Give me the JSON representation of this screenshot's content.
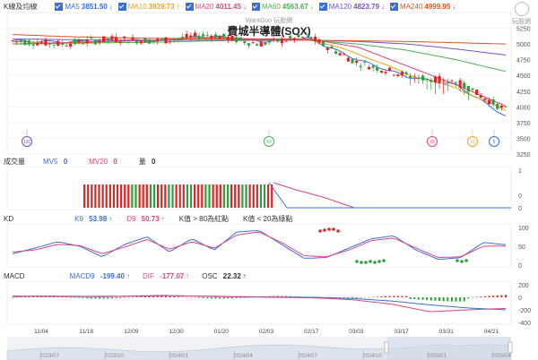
{
  "header_kline": {
    "label": "K線及均線",
    "items": [
      {
        "name": "MA5",
        "value": "3851.50",
        "arrow": "↓",
        "color": "#3a6fd8"
      },
      {
        "name": "MA10",
        "value": "3939.73",
        "arrow": "↑",
        "color": "#e8a317"
      },
      {
        "name": "MA20",
        "value": "4011.45",
        "arrow": "↓",
        "color": "#e0457b"
      },
      {
        "name": "MA60",
        "value": "4563.67",
        "arrow": "↓",
        "color": "#4caf50"
      },
      {
        "name": "MA120",
        "value": "4823.79",
        "arrow": "↓",
        "color": "#7b4fc9"
      },
      {
        "name": "MA240",
        "value": "4999.95",
        "arrow": "↓",
        "color": "#e0541d"
      }
    ]
  },
  "watermark": "WantGoo 玩股網",
  "chart_title": "費城半導體(SOX)",
  "logo_text": "玩股網",
  "header_volume": {
    "label": "成交量",
    "items": [
      {
        "name": "MV5",
        "value": "0",
        "color": "#3a6fd8"
      },
      {
        "name": "MV20",
        "value": "0",
        "color": "#e0457b"
      },
      {
        "name": "量",
        "value": "0",
        "color": "#333333"
      }
    ]
  },
  "header_kd": {
    "label": "KD",
    "items": [
      {
        "name": "K9",
        "value": "53.98",
        "arrow": "↑",
        "color": "#3a6fd8"
      },
      {
        "name": "D9",
        "value": "50.73",
        "arrow": "↑",
        "color": "#e0457b"
      }
    ],
    "notes": [
      "K值 > 80為紅點",
      "K值 < 20為綠點"
    ]
  },
  "header_macd": {
    "label": "MACD",
    "items": [
      {
        "name": "MACD9",
        "value": "-199.40",
        "arrow": "↑",
        "color": "#3a6fd8"
      },
      {
        "name": "DIF",
        "value": "-177.07",
        "arrow": "↑",
        "color": "#e0457b"
      },
      {
        "name": "OSC",
        "value": "22.32",
        "arrow": "↑",
        "color": "#333333"
      }
    ]
  },
  "price_axis": [
    "5250",
    "5000",
    "4750",
    "4500",
    "4250",
    "4000",
    "3750",
    "3500",
    "3250"
  ],
  "volume_axis": [
    "1",
    "0",
    "0"
  ],
  "kd_axis": [
    "100",
    "50",
    "0"
  ],
  "macd_axis": [
    "200",
    "0",
    "-200",
    "-400"
  ],
  "date_labels": [
    "11/04",
    "11/18",
    "12/09",
    "12/30",
    "01/20",
    "02/03",
    "02/17",
    "03/03",
    "03/17",
    "03/31",
    "04/21"
  ],
  "timeline_labels": [
    "2023/07",
    "2023/10",
    "2024/01",
    "2024/04",
    "2024/07",
    "2024/10",
    "2025/01",
    "2025/04"
  ],
  "markers": [
    {
      "label": "120",
      "color": "#7b4fc9"
    },
    {
      "label": "60",
      "color": "#4caf50"
    },
    {
      "label": "20",
      "color": "#e0457b"
    },
    {
      "label": "10",
      "color": "#e8a317"
    },
    {
      "label": "5",
      "color": "#3a6fd8"
    }
  ],
  "chart_data": [
    {
      "type": "candlestick",
      "ylim": [
        3250,
        5500
      ],
      "x": [
        "11/04",
        "11/18",
        "12/09",
        "12/30",
        "01/20",
        "02/03",
        "02/17",
        "03/03",
        "03/17",
        "03/31",
        "04/21"
      ],
      "close": [
        5050,
        5000,
        5080,
        5050,
        5150,
        5000,
        5120,
        4700,
        4500,
        4400,
        3950
      ],
      "series": [
        {
          "name": "MA5",
          "values": [
            5050,
            5030,
            5060,
            5050,
            5130,
            5040,
            5090,
            4750,
            4480,
            4350,
            3851.5
          ]
        },
        {
          "name": "MA10",
          "values": [
            5030,
            5020,
            5050,
            5060,
            5120,
            5060,
            5080,
            4850,
            4520,
            4300,
            3939.73
          ]
        },
        {
          "name": "MA20",
          "values": [
            5000,
            5020,
            5040,
            5060,
            5100,
            5080,
            5080,
            4950,
            4650,
            4350,
            4011.45
          ]
        },
        {
          "name": "MA60",
          "values": [
            5000,
            5010,
            5020,
            5030,
            5050,
            5060,
            5060,
            5000,
            4900,
            4750,
            4563.67
          ]
        },
        {
          "name": "MA120",
          "values": [
            5080,
            5070,
            5060,
            5060,
            5060,
            5060,
            5060,
            5040,
            5000,
            4920,
            4823.79
          ]
        },
        {
          "name": "MA240",
          "values": [
            5150,
            5120,
            5100,
            5090,
            5080,
            5070,
            5060,
            5050,
            5040,
            5020,
            4999.95
          ]
        }
      ]
    },
    {
      "type": "bar",
      "name": "成交量",
      "ylim": [
        0,
        1
      ]
    },
    {
      "type": "line",
      "ylim": [
        0,
        100
      ],
      "series": [
        {
          "name": "K9",
          "values": [
            30,
            45,
            62,
            50,
            22,
            55,
            75,
            35,
            70,
            40,
            88,
            92,
            55,
            18,
            20,
            45,
            70,
            78,
            40,
            15,
            20,
            60,
            53.98
          ]
        },
        {
          "name": "D9",
          "values": [
            35,
            40,
            55,
            52,
            30,
            48,
            68,
            42,
            62,
            45,
            80,
            88,
            60,
            25,
            22,
            40,
            65,
            72,
            45,
            20,
            22,
            50,
            50.73
          ]
        }
      ]
    },
    {
      "type": "line",
      "ylim": [
        -400,
        200
      ],
      "series": [
        {
          "name": "MACD9",
          "values": [
            20,
            15,
            10,
            15,
            25,
            20,
            10,
            5,
            0,
            -20,
            -60,
            -120,
            -170,
            -199.4
          ]
        },
        {
          "name": "DIF",
          "values": [
            10,
            20,
            15,
            20,
            30,
            15,
            5,
            0,
            -10,
            -40,
            -110,
            -230,
            -200,
            -177.07
          ]
        }
      ],
      "osc_last": 22.32
    }
  ]
}
